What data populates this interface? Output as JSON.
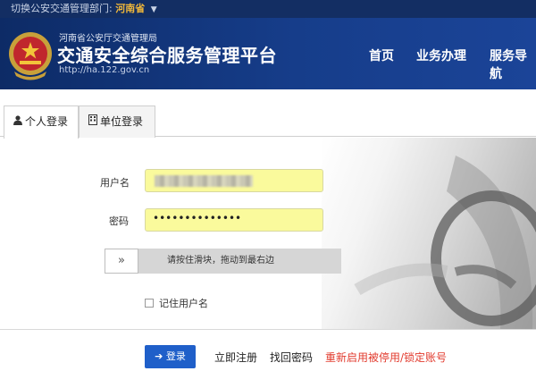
{
  "topbar": {
    "switch_label": "切换公安交通管理部门:",
    "province": "河南省"
  },
  "header": {
    "org": "河南省公安厅交通管理局",
    "title": "交通安全综合服务管理平台",
    "site": "http://ha.122.gov.cn",
    "nav": [
      "首页",
      "业务办理",
      "服务导航"
    ]
  },
  "tabs": [
    {
      "label": "个人登录",
      "icon": "user-icon"
    },
    {
      "label": "单位登录",
      "icon": "building-icon"
    }
  ],
  "form": {
    "username_label": "用户名",
    "password_label": "密码",
    "password_value": "••••••••••••••",
    "slider_text": "请按住滑块，拖动到最右边",
    "slider_knob": "»",
    "remember_label": "记住用户名"
  },
  "actions": {
    "login": "登录",
    "register": "立即注册",
    "forgot": "找回密码",
    "reactivate": "重新启用被停用/锁定账号"
  },
  "colors": {
    "header": "#163d8a",
    "input_bg": "#fafa9c",
    "login_button": "#1f5fc9",
    "alert_link": "#e23b2e"
  }
}
